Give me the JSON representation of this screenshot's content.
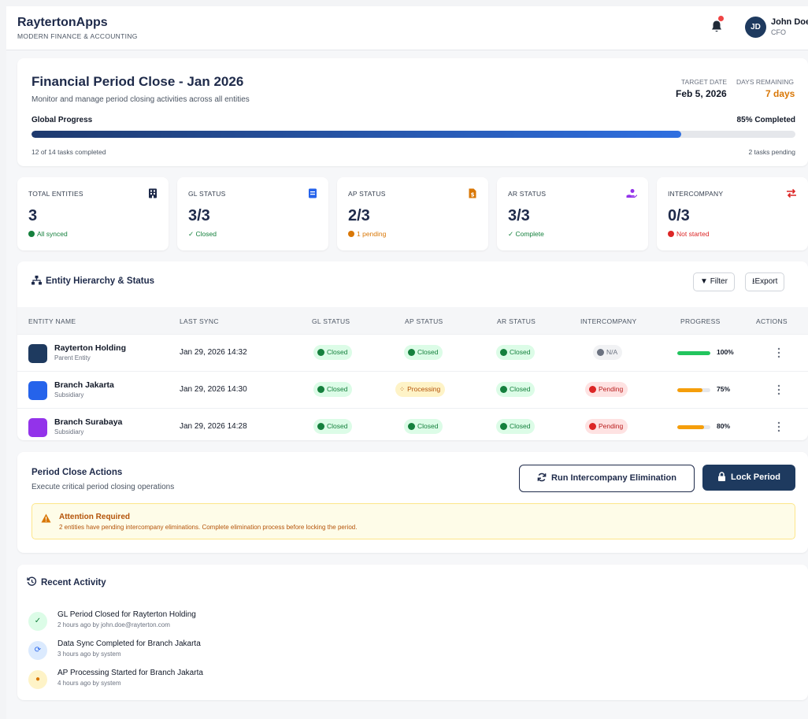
{
  "app": {
    "name": "RaytertonApps",
    "tagline": "MODERN FINANCE & ACCOUNTING"
  },
  "user": {
    "initials": "JD",
    "name": "John Doe",
    "role": "CFO"
  },
  "colors": {
    "primary": "#1e3a5f",
    "accent": "#2f6fe0",
    "warning": "#d97706",
    "success": "#15803d",
    "danger": "#dc2626"
  },
  "hero": {
    "title": "Financial Period Close - Jan 2026",
    "subtitle": "Monitor and manage period closing activities across all entities",
    "target_label": "TARGET DATE",
    "target_value": "Feb 5, 2026",
    "days_label": "DAYS REMAINING",
    "days_value": "7 days",
    "progress_label": "Global Progress",
    "progress_text": "85% Completed",
    "progress_value": 85,
    "tasks_completed": "12 of 14 tasks completed",
    "tasks_pending": "2 tasks pending"
  },
  "stats": [
    {
      "label": "TOTAL ENTITIES",
      "value": "3",
      "note": "All synced",
      "icon": "building-icon",
      "status": "success"
    },
    {
      "label": "GL STATUS",
      "value": "3/3",
      "note": "✓ Closed",
      "icon": "ledger-icon",
      "status": "success"
    },
    {
      "label": "AP STATUS",
      "value": "2/3",
      "note": "1 pending",
      "icon": "invoice-icon",
      "status": "warning"
    },
    {
      "label": "AR STATUS",
      "value": "3/3",
      "note": "✓ Complete",
      "icon": "hand-coin-icon",
      "status": "success"
    },
    {
      "label": "INTERCOMPANY",
      "value": "0/3",
      "note": "Not started",
      "icon": "exchange-icon",
      "status": "danger"
    }
  ],
  "table": {
    "title": "Entity Hierarchy & Status",
    "filter_label": "Filter",
    "export_label": "Export",
    "columns": [
      "ENTITY NAME",
      "LAST SYNC",
      "GL STATUS",
      "AP STATUS",
      "AR STATUS",
      "INTERCOMPANY",
      "PROGRESS",
      "ACTIONS"
    ],
    "rows": [
      {
        "name": "Rayterton Holding",
        "type": "Parent Entity",
        "last_sync": "Jan 29, 2026 14:32",
        "gl": "Closed",
        "ap": "Closed",
        "ar": "Closed",
        "ic": "N/A",
        "progress": 100,
        "progress_text": "100%"
      },
      {
        "name": "Branch Jakarta",
        "type": "Subsidiary",
        "last_sync": "Jan 29, 2026 14:30",
        "gl": "Closed",
        "ap": "Processing",
        "ar": "Closed",
        "ic": "Pending",
        "progress": 75,
        "progress_text": "75%"
      },
      {
        "name": "Branch Surabaya",
        "type": "Subsidiary",
        "last_sync": "Jan 29, 2026 14:28",
        "gl": "Closed",
        "ap": "Closed",
        "ar": "Closed",
        "ic": "Pending",
        "progress": 80,
        "progress_text": "80%"
      }
    ]
  },
  "actions": {
    "title": "Period Close Actions",
    "subtitle": "Execute critical period closing operations",
    "run_label": "Run Intercompany Elimination",
    "lock_label": "Lock Period",
    "alert_title": "Attention Required",
    "alert_text": "2 entities have pending intercompany eliminations. Complete elimination process before locking the period."
  },
  "activity": {
    "title": "Recent Activity",
    "items": [
      {
        "text": "GL Period Closed for Rayterton Holding",
        "meta": "2 hours ago by john.doe@rayterton.com",
        "icon": "check-icon"
      },
      {
        "text": "Data Sync Completed for Branch Jakarta",
        "meta": "3 hours ago by system",
        "icon": "sync-icon"
      },
      {
        "text": "AP Processing Started for Branch Jakarta",
        "meta": "4 hours ago by system",
        "icon": "clock-icon"
      }
    ]
  }
}
